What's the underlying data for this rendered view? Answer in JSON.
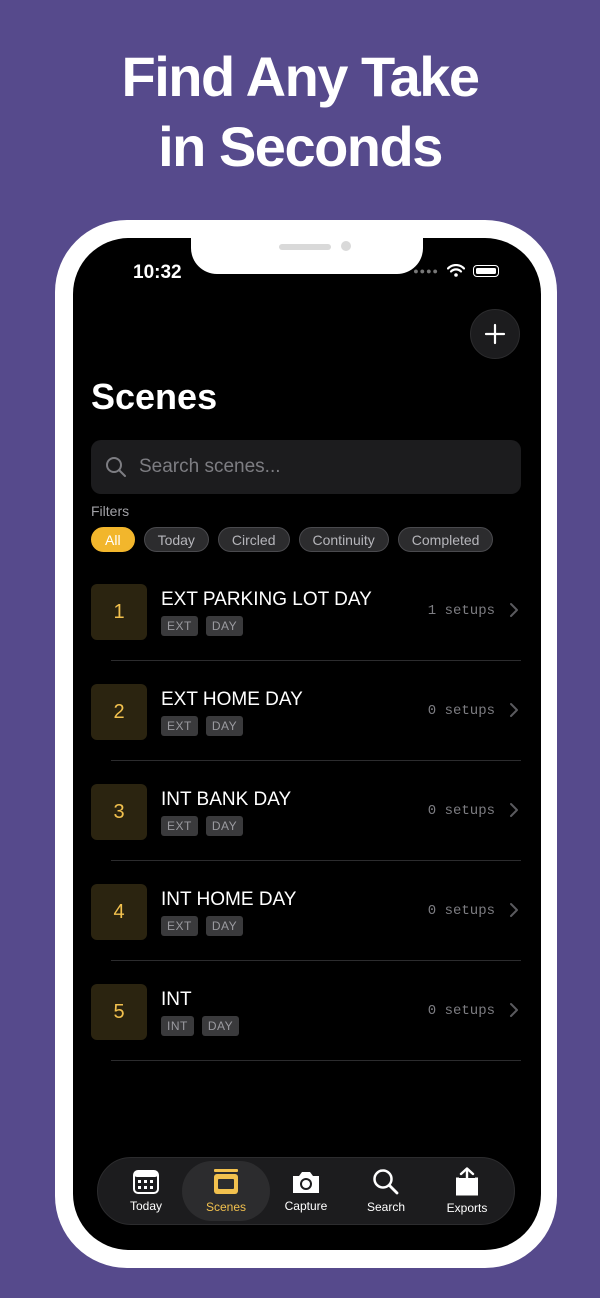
{
  "headline": {
    "line1": "Find Any Take",
    "line2": "in Seconds"
  },
  "status_bar": {
    "time": "10:32"
  },
  "header": {
    "title": "Scenes",
    "add_icon": "plus-icon"
  },
  "search": {
    "placeholder": "Search scenes..."
  },
  "filters": {
    "label": "Filters",
    "chips": [
      {
        "label": "All",
        "active": true
      },
      {
        "label": "Today"
      },
      {
        "label": "Circled"
      },
      {
        "label": "Continuity"
      },
      {
        "label": "Completed"
      }
    ]
  },
  "scenes": [
    {
      "number": "1",
      "title": "EXT PARKING LOT DAY",
      "tags": [
        "EXT",
        "DAY"
      ],
      "setups": "1 setups"
    },
    {
      "number": "2",
      "title": "EXT HOME DAY",
      "tags": [
        "EXT",
        "DAY"
      ],
      "setups": "0 setups"
    },
    {
      "number": "3",
      "title": "INT BANK DAY",
      "tags": [
        "EXT",
        "DAY"
      ],
      "setups": "0 setups"
    },
    {
      "number": "4",
      "title": "INT HOME DAY",
      "tags": [
        "EXT",
        "DAY"
      ],
      "setups": "0 setups"
    },
    {
      "number": "5",
      "title": "INT",
      "tags": [
        "INT",
        "DAY"
      ],
      "setups": "0 setups"
    }
  ],
  "tabbar": {
    "tabs": [
      {
        "label": "Today",
        "icon": "calendar-icon"
      },
      {
        "label": "Scenes",
        "icon": "film-strip-icon",
        "active": true
      },
      {
        "label": "Capture",
        "icon": "camera-icon"
      },
      {
        "label": "Search",
        "icon": "magnifier-icon"
      },
      {
        "label": "Exports",
        "icon": "share-icon"
      }
    ]
  },
  "colors": {
    "background": "#564a8c",
    "accent": "#f2c14e",
    "chip_active": "#f2b62c",
    "screen": "#000000"
  }
}
